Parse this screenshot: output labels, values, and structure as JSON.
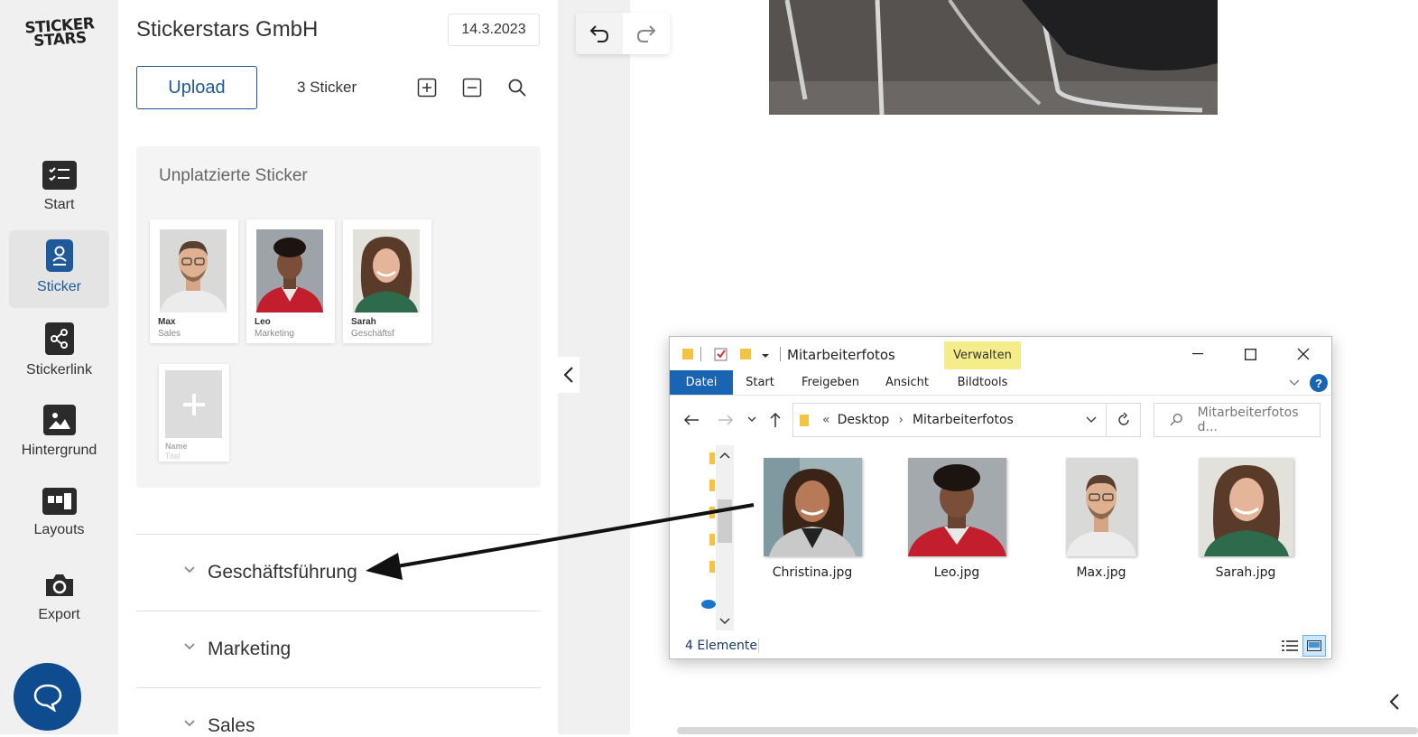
{
  "brand": {
    "logo_line1": "STICKER",
    "logo_line2": "STARS"
  },
  "sidebar": {
    "items": [
      {
        "label": "Start",
        "icon": "checklist-icon"
      },
      {
        "label": "Sticker",
        "icon": "badge-icon",
        "active": true
      },
      {
        "label": "Stickerlink",
        "icon": "share-icon"
      },
      {
        "label": "Hintergrund",
        "icon": "image-icon"
      },
      {
        "label": "Layouts",
        "icon": "layout-icon"
      },
      {
        "label": "Export",
        "icon": "camera-icon"
      }
    ],
    "chat_icon": "chat-bubble-icon"
  },
  "panel": {
    "company": "Stickerstars GmbH",
    "date": "14.3.2023",
    "upload_label": "Upload",
    "sticker_count": "3 Sticker",
    "unplaced_title": "Unplatzierte Sticker",
    "stickers": [
      {
        "name": "Max",
        "role": "Sales"
      },
      {
        "name": "Leo",
        "role": "Marketing"
      },
      {
        "name": "Sarah",
        "role": "Geschäftsf"
      }
    ],
    "placeholder": {
      "name": "Name",
      "role": "Titel"
    },
    "groups": [
      {
        "label": "Geschäftsführung"
      },
      {
        "label": "Marketing"
      },
      {
        "label": "Sales"
      }
    ]
  },
  "explorer": {
    "title": "Mitarbeiterfotos",
    "context_tab": "Verwalten",
    "ribbon_tabs": [
      "Datei",
      "Start",
      "Freigeben",
      "Ansicht",
      "Bildtools"
    ],
    "help": "?",
    "path": {
      "prefix": "«",
      "part1": "Desktop",
      "part2": "Mitarbeiterfotos"
    },
    "search_placeholder": "Mitarbeiterfotos d...",
    "files": [
      "Christina.jpg",
      "Leo.jpg",
      "Max.jpg",
      "Sarah.jpg"
    ],
    "status": "4 Elemente"
  },
  "colors": {
    "accent": "#1e5a99",
    "chat": "#0f4c8f",
    "explorer_blue": "#1a64b4",
    "verwalten": "#f4ed8a"
  }
}
